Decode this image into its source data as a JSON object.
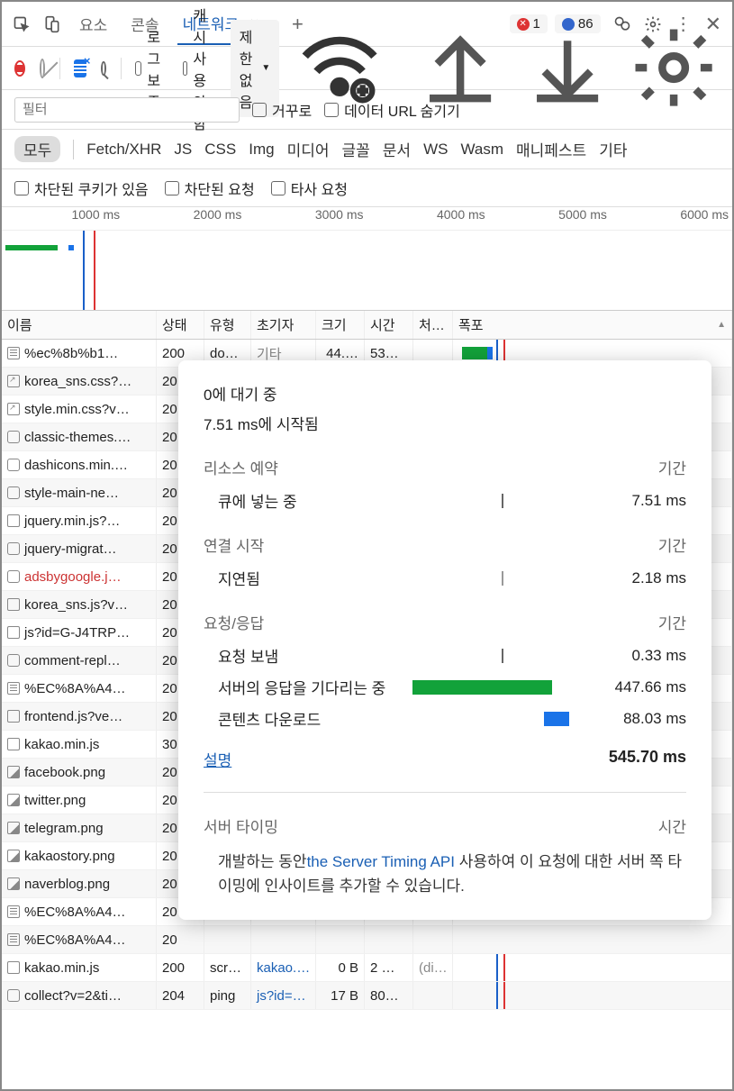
{
  "tabs": {
    "t0": "요소",
    "t1": "콘솔",
    "t2": "네트워크"
  },
  "badges": {
    "err": "1",
    "msg": "86"
  },
  "toolbar": {
    "log": "로그 보존",
    "cache": "캐시 사용 안 함",
    "throttle": "제한 없음"
  },
  "filter": {
    "placeholder": "필터",
    "invert": "거꾸로",
    "hideurl": "데이터 URL 숨기기"
  },
  "types": {
    "all": "모두",
    "fetch": "Fetch/XHR",
    "js": "JS",
    "css": "CSS",
    "img": "Img",
    "media": "미디어",
    "font": "글꼴",
    "doc": "문서",
    "ws": "WS",
    "wasm": "Wasm",
    "manifest": "매니페스트",
    "other": "기타"
  },
  "ext": {
    "cookies": "차단된 쿠키가 있음",
    "blocked": "차단된 요청",
    "third": "타사 요청"
  },
  "overview_ticks": [
    "1000 ms",
    "2000 ms",
    "3000 ms",
    "4000 ms",
    "5000 ms",
    "6000 ms"
  ],
  "columns": {
    "name": "이름",
    "status": "상태",
    "type": "유형",
    "initiator": "초기자",
    "size": "크기",
    "time": "시간",
    "chdr": "처…",
    "waterfall": "폭포"
  },
  "rows": [
    {
      "name": "%ec%8b%b1…",
      "status": "200",
      "type": "do…",
      "init": "기타",
      "size": "44.…",
      "time": "53…",
      "chdr": "",
      "wf": "g"
    },
    {
      "name": "korea_sns.css?…",
      "status": "20",
      "type": "",
      "init": "",
      "size": "",
      "time": "",
      "chdr": ""
    },
    {
      "name": "style.min.css?v…",
      "status": "20",
      "type": "",
      "init": "",
      "size": "",
      "time": "",
      "chdr": ""
    },
    {
      "name": "classic-themes.…",
      "status": "20",
      "type": "",
      "init": "",
      "size": "",
      "time": "",
      "chdr": ""
    },
    {
      "name": "dashicons.min.…",
      "status": "20",
      "type": "",
      "init": "",
      "size": "",
      "time": "",
      "chdr": ""
    },
    {
      "name": "style-main-ne…",
      "status": "20",
      "type": "",
      "init": "",
      "size": "",
      "time": "",
      "chdr": ""
    },
    {
      "name": "jquery.min.js?…",
      "status": "20",
      "type": "",
      "init": "",
      "size": "",
      "time": "",
      "chdr": ""
    },
    {
      "name": "jquery-migrat…",
      "status": "20",
      "type": "",
      "init": "",
      "size": "",
      "time": "",
      "chdr": ""
    },
    {
      "name": "adsbygoogle.j…",
      "status": "20",
      "type": "",
      "init": "",
      "size": "",
      "time": "",
      "chdr": "",
      "blocked": true
    },
    {
      "name": "korea_sns.js?v…",
      "status": "20",
      "type": "",
      "init": "",
      "size": "",
      "time": "",
      "chdr": ""
    },
    {
      "name": "js?id=G-J4TRP…",
      "status": "20",
      "type": "",
      "init": "",
      "size": "",
      "time": "",
      "chdr": ""
    },
    {
      "name": "comment-repl…",
      "status": "20",
      "type": "",
      "init": "",
      "size": "",
      "time": "",
      "chdr": ""
    },
    {
      "name": "%EC%8A%A4…",
      "status": "20",
      "type": "",
      "init": "",
      "size": "",
      "time": "",
      "chdr": ""
    },
    {
      "name": "frontend.js?ve…",
      "status": "20",
      "type": "",
      "init": "",
      "size": "",
      "time": "",
      "chdr": ""
    },
    {
      "name": "kakao.min.js",
      "status": "30",
      "type": "",
      "init": "",
      "size": "",
      "time": "",
      "chdr": ""
    },
    {
      "name": "facebook.png",
      "status": "20",
      "type": "",
      "init": "",
      "size": "",
      "time": "",
      "chdr": ""
    },
    {
      "name": "twitter.png",
      "status": "20",
      "type": "",
      "init": "",
      "size": "",
      "time": "",
      "chdr": ""
    },
    {
      "name": "telegram.png",
      "status": "20",
      "type": "",
      "init": "",
      "size": "",
      "time": "",
      "chdr": ""
    },
    {
      "name": "kakaostory.png",
      "status": "20",
      "type": "",
      "init": "",
      "size": "",
      "time": "",
      "chdr": ""
    },
    {
      "name": "naverblog.png",
      "status": "20",
      "type": "",
      "init": "",
      "size": "",
      "time": "",
      "chdr": ""
    },
    {
      "name": "%EC%8A%A4…",
      "status": "20",
      "type": "",
      "init": "",
      "size": "",
      "time": "",
      "chdr": ""
    },
    {
      "name": "%EC%8A%A4…",
      "status": "20",
      "type": "",
      "init": "",
      "size": "",
      "time": "",
      "chdr": ""
    },
    {
      "name": "kakao.min.js",
      "status": "200",
      "type": "scr…",
      "init": "kakao.…",
      "size": "0 B",
      "time": "2 …",
      "chdr": "(di…",
      "wf": "line"
    },
    {
      "name": "collect?v=2&ti…",
      "status": "204",
      "type": "ping",
      "init": "js?id=…",
      "size": "17 B",
      "time": "80…",
      "chdr": "",
      "wf": "line"
    }
  ],
  "tooltip": {
    "queued": "0에 대기 중",
    "started": "7.51 ms에 시작됨",
    "sec1": "리소스 예약",
    "col_dur": "기간",
    "queuing": "큐에 넣는 중",
    "queuing_v": "7.51 ms",
    "sec2": "연결 시작",
    "stalled": "지연됨",
    "stalled_v": "2.18 ms",
    "sec3": "요청/응답",
    "sent": "요청 보냄",
    "sent_v": "0.33 ms",
    "waiting": "서버의 응답을 기다리는 중",
    "waiting_v": "447.66 ms",
    "download": "콘텐츠 다운로드",
    "download_v": "88.03 ms",
    "explain": "설명",
    "total": "545.70 ms",
    "srv_head": "서버 타이밍",
    "srv_col": "시간",
    "srv_body1": "개발하는 동안",
    "srv_link": "the Server Timing API",
    "srv_body2": " 사용하여 이 요청에 대한 서버 쪽 타이밍에 인사이트를 추가할 수 있습니다."
  }
}
